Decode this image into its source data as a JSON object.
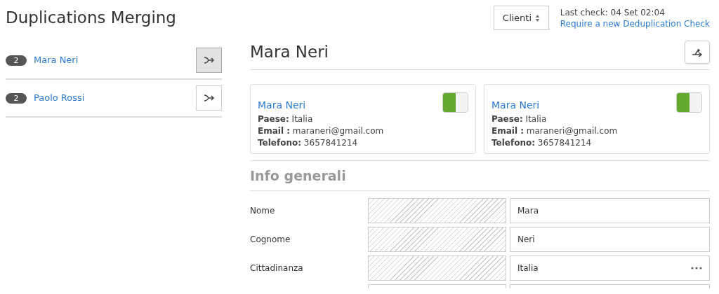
{
  "page_title": "Duplications Merging",
  "entity_select": {
    "value": "Clienti"
  },
  "last_check": "Last check: 04 Set 02:04",
  "recheck_link": "Require a new Deduplication Check",
  "duplicates": [
    {
      "count": "2",
      "name": "Mara Neri",
      "selected": true
    },
    {
      "count": "2",
      "name": "Paolo Rossi",
      "selected": false
    }
  ],
  "detail": {
    "title": "Mara Neri",
    "records": [
      {
        "name": "Mara Neri",
        "on": true,
        "lines": [
          "**Paese:** Italia",
          "**Email :** maraneri@gmail.com",
          "**Telefono:** 3657841214"
        ]
      },
      {
        "name": "Mara Neri",
        "on": true,
        "lines": [
          "**Paese:** Italia",
          "**Email :** maraneri@gmail.com",
          "**Telefono:** 3657841214"
        ]
      }
    ],
    "section_title": "Info generali",
    "fields": [
      {
        "label": "Nome",
        "value": "Mara",
        "has_menu": false
      },
      {
        "label": "Cognome",
        "value": "Neri",
        "has_menu": false
      },
      {
        "label": "Cittadinanza",
        "value": "Italia",
        "has_menu": true
      }
    ]
  }
}
